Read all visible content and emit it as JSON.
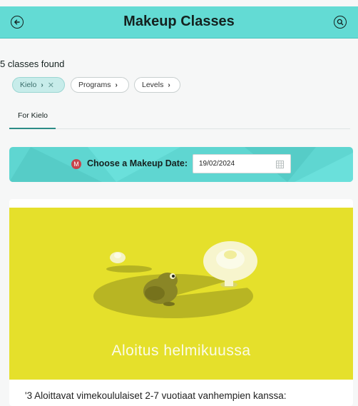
{
  "header": {
    "title": "Makeup Classes",
    "back_icon": "arrow-left-icon",
    "search_icon": "search-icon"
  },
  "results": {
    "count_text": "5 classes found"
  },
  "filters": [
    {
      "label": "Kielo",
      "active": true,
      "removable": true
    },
    {
      "label": "Programs",
      "active": false,
      "removable": false
    },
    {
      "label": "Levels",
      "active": false,
      "removable": false
    }
  ],
  "tabs": [
    {
      "label": "For Kielo",
      "selected": true
    }
  ],
  "date_picker": {
    "badge": "M",
    "label": "Choose a Makeup Date:",
    "value": "19/02/2024",
    "icon": "calendar-icon"
  },
  "class_card": {
    "image_caption": "Aloitus helmikuussa",
    "description": "'3 Aloittavat vimekoululaiset 2-7 vuotiaat vanhempien kanssa:"
  },
  "colors": {
    "header_bg": "#63dbd4",
    "hero_bg": "#e5e02b",
    "badge_bg": "#c8424a"
  }
}
